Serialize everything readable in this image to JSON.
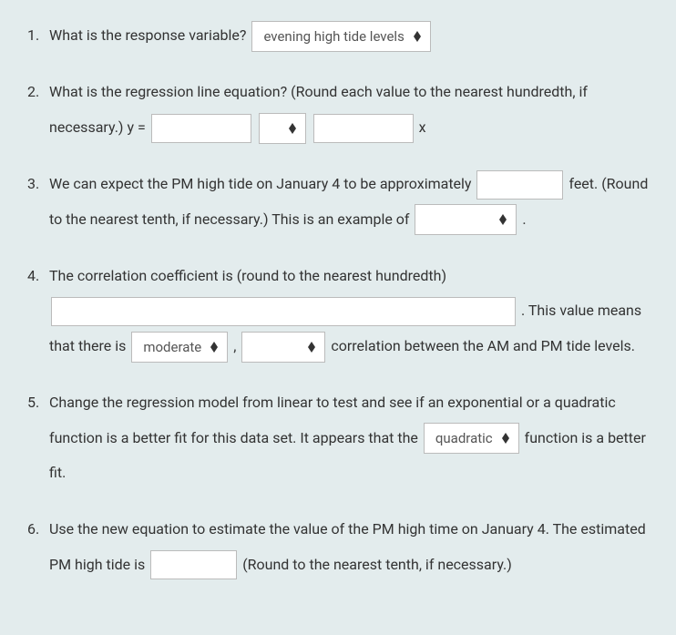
{
  "q1": {
    "text": "What is the response variable?",
    "select_value": "evening high tide levels"
  },
  "q2": {
    "text_before": "What is the regression line equation? (Round each value to the nearest hundredth, if necessary.) y =",
    "text_after": "x",
    "input1_value": "",
    "select_value": "",
    "input2_value": ""
  },
  "q3": {
    "text_before": "We can expect the PM high tide on January 4 to be approximately",
    "text_mid": "feet. (Round to the nearest tenth, if necessary.) This is an example of",
    "text_after": ".",
    "input_value": "",
    "select_value": ""
  },
  "q4": {
    "text_before": "The correlation coefficient is (round to the nearest hundredth)",
    "text_after_input": ". This value means that there is",
    "comma": ",",
    "text_end": "correlation between the AM and PM tide levels.",
    "coeff_value": "",
    "select1_value": "moderate",
    "select2_value": ""
  },
  "q5": {
    "text_before": "Change the regression model from linear to test and see if an exponential or a quadratic function is a better fit for this data set. It appears that the",
    "text_after": "function is a better fit.",
    "select_value": "quadratic"
  },
  "q6": {
    "text_before": "Use the new equation to estimate the value of the PM high time on January 4. The estimated PM high tide is",
    "text_after": "(Round to the nearest tenth, if necessary.)",
    "input_value": ""
  }
}
